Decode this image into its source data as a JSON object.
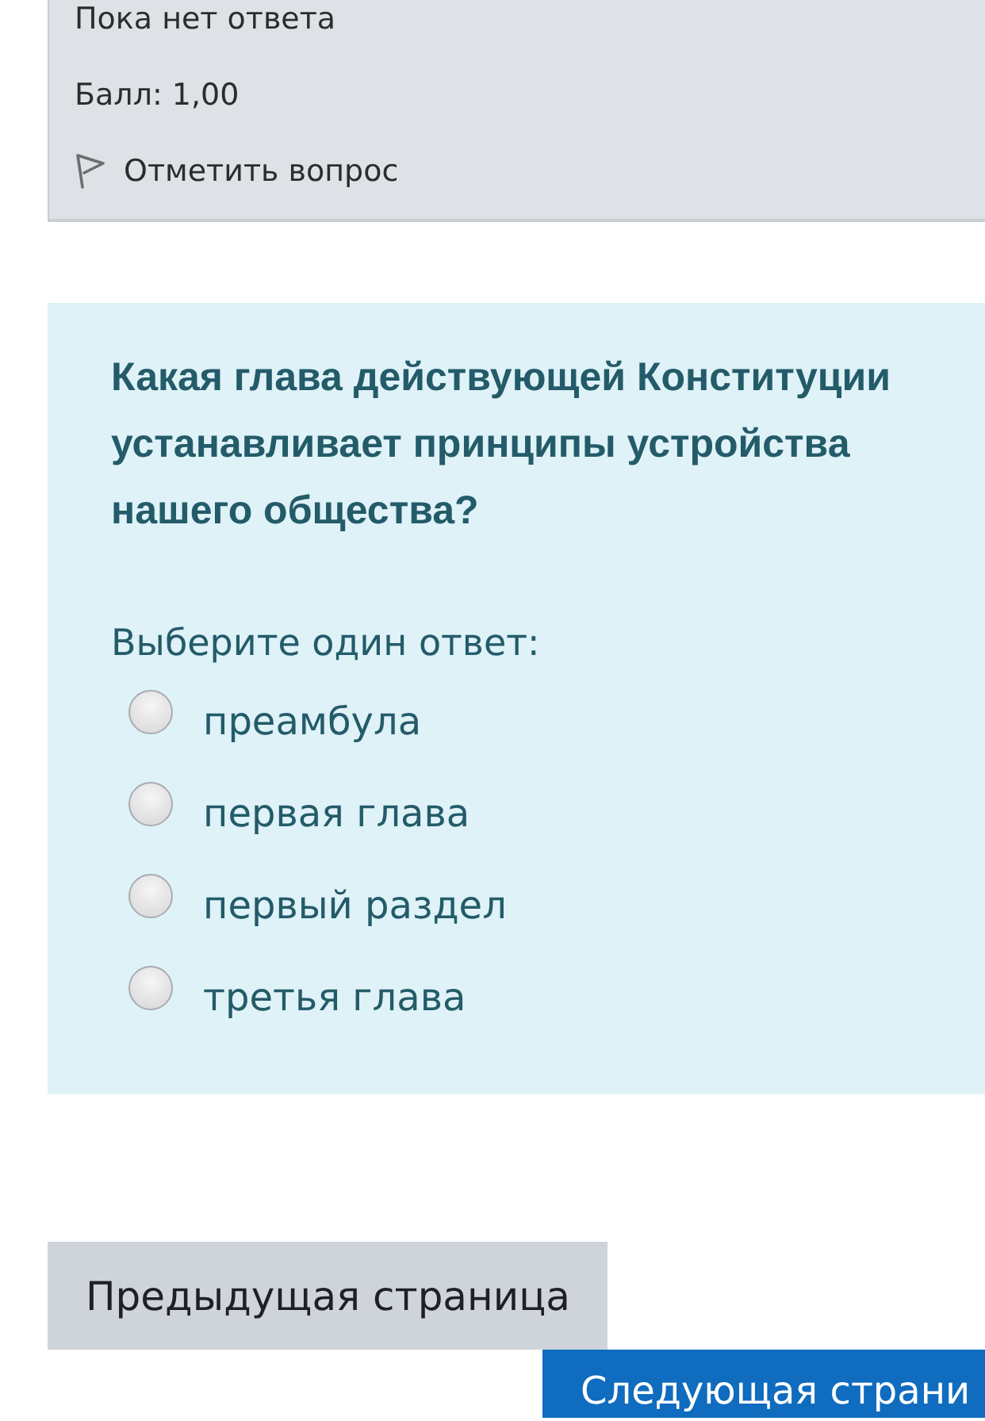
{
  "status": {
    "answer_state": "Пока нет ответа",
    "mark": "Балл: 1,00",
    "flag": {
      "label": "Отметить вопрос",
      "flagged": false
    }
  },
  "question": {
    "text": "Какая глава действующей Конституции устанавливает принципы устройства нашего общества?",
    "prompt": "Выберите один ответ:",
    "options": [
      {
        "label": "преамбула",
        "selected": false
      },
      {
        "label": "первая глава",
        "selected": false
      },
      {
        "label": "первый раздел",
        "selected": false
      },
      {
        "label": "третья глава",
        "selected": false
      }
    ]
  },
  "navigation": {
    "previous": "Предыдущая страница",
    "next": "Следующая страни"
  }
}
